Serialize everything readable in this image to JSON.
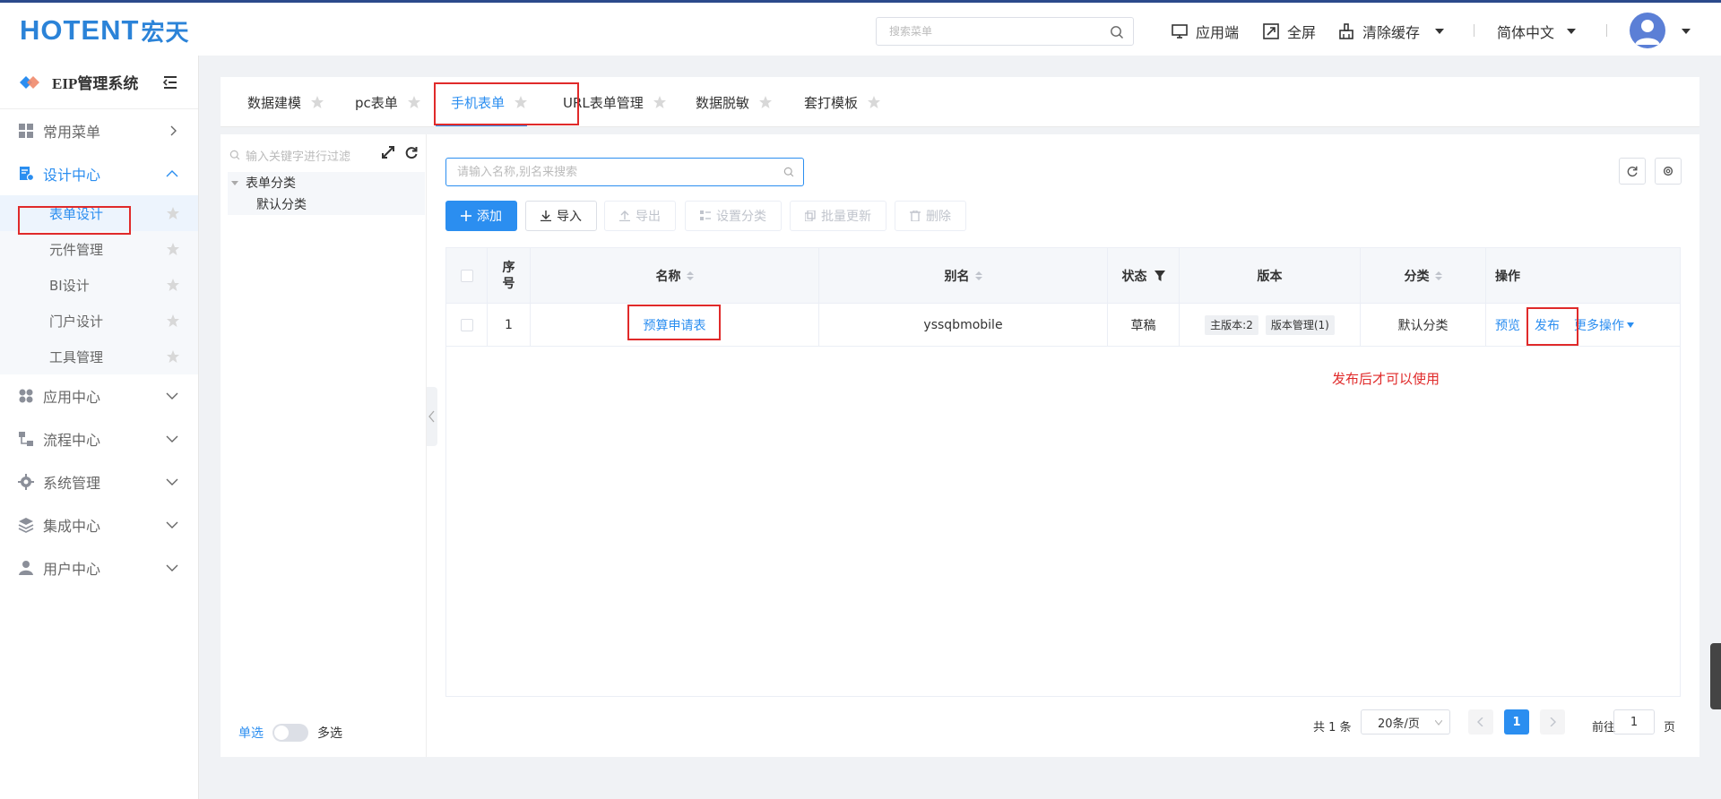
{
  "header": {
    "logo_text": "HOTENT",
    "logo_cn": "宏天",
    "search_placeholder": "搜索菜单",
    "items": {
      "app": "应用端",
      "fullscreen": "全屏",
      "clear_cache": "清除缓存",
      "language": "简体中文"
    }
  },
  "sidebar": {
    "system_title": "EIP管理系统",
    "menus": [
      {
        "label": "常用菜单",
        "icon": "grid-icon"
      },
      {
        "label": "设计中心",
        "icon": "doc-settings-icon",
        "expanded": true
      },
      {
        "label": "应用中心",
        "icon": "apps-icon"
      },
      {
        "label": "流程中心",
        "icon": "flow-icon"
      },
      {
        "label": "系统管理",
        "icon": "gear-icon"
      },
      {
        "label": "集成中心",
        "icon": "layers-icon"
      },
      {
        "label": "用户中心",
        "icon": "user-icon"
      }
    ],
    "submenu": [
      {
        "label": "表单设计",
        "active": true
      },
      {
        "label": "元件管理"
      },
      {
        "label": "BI设计"
      },
      {
        "label": "门户设计"
      },
      {
        "label": "工具管理"
      }
    ]
  },
  "tabs": [
    {
      "label": "数据建模"
    },
    {
      "label": "pc表单"
    },
    {
      "label": "手机表单",
      "active": true
    },
    {
      "label": "URL表单管理"
    },
    {
      "label": "数据脱敏"
    },
    {
      "label": "套打模板"
    }
  ],
  "tree": {
    "search_placeholder": "输入关键字进行过滤",
    "root": "表单分类",
    "child": "默认分类",
    "single": "单选",
    "multi": "多选"
  },
  "list": {
    "search_placeholder": "请输入名称,别名来搜索",
    "buttons": {
      "add": "添加",
      "import": "导入",
      "export": "导出",
      "set_category": "设置分类",
      "batch_update": "批量更新",
      "delete": "删除"
    },
    "columns": {
      "seq": "序号",
      "name": "名称",
      "alias": "别名",
      "status": "状态",
      "version": "版本",
      "category": "分类",
      "actions": "操作"
    },
    "rows": [
      {
        "seq": "1",
        "name": "预算申请表",
        "alias": "yssqbmobile",
        "status": "草稿",
        "version_main": "主版本:2",
        "version_manage": "版本管理(1)",
        "category": "默认分类",
        "preview": "预览",
        "publish": "发布",
        "more": "更多操作"
      }
    ],
    "note": "发布后才可以使用"
  },
  "pagination": {
    "total": "共 1 条",
    "page_size": "20条/页",
    "current": "1",
    "goto_prefix": "前往",
    "goto_value": "1",
    "goto_suffix": "页"
  }
}
